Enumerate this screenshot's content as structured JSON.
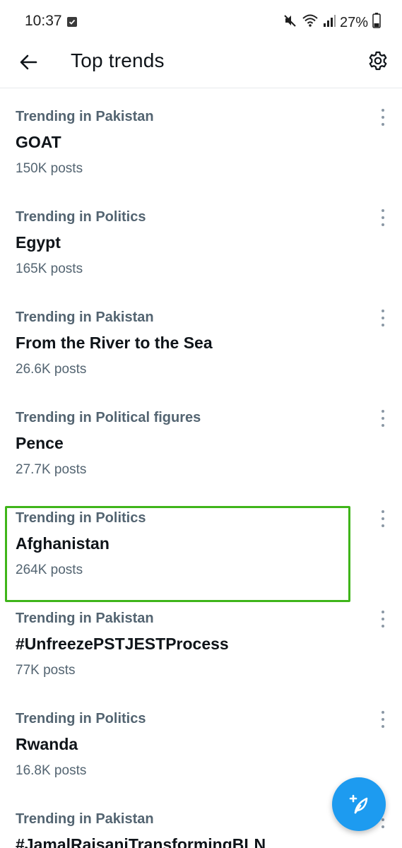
{
  "status_bar": {
    "time": "10:37",
    "battery": "27%",
    "icons": [
      "check-square-icon",
      "mute-icon",
      "wifi-icon",
      "signal-icon",
      "battery-icon"
    ]
  },
  "header": {
    "title": "Top trends",
    "back_icon": "arrow-left-icon",
    "settings_icon": "gear-icon"
  },
  "trends": [
    {
      "category": "Trending in Pakistan",
      "name": "GOAT",
      "count": "150K posts"
    },
    {
      "category": "Trending in Politics",
      "name": "Egypt",
      "count": "165K posts"
    },
    {
      "category": "Trending in Pakistan",
      "name": "From the River to the Sea",
      "count": "26.6K posts"
    },
    {
      "category": "Trending in Political figures",
      "name": "Pence",
      "count": "27.7K posts"
    },
    {
      "category": "Trending in Politics",
      "name": "Afghanistan",
      "count": "264K posts"
    },
    {
      "category": "Trending in Pakistan",
      "name": "#UnfreezePSTJESTProcess",
      "count": "77K posts"
    },
    {
      "category": "Trending in Politics",
      "name": "Rwanda",
      "count": "16.8K posts"
    },
    {
      "category": "Trending in Pakistan",
      "name": "#JamalRaisaniTransformingBLN",
      "count": ""
    }
  ],
  "fab": {
    "icon": "compose-feather-icon"
  },
  "colors": {
    "accent": "#1d9bf0",
    "highlight": "#3fb51a",
    "secondary_text": "#536471",
    "primary_text": "#0f1419"
  }
}
